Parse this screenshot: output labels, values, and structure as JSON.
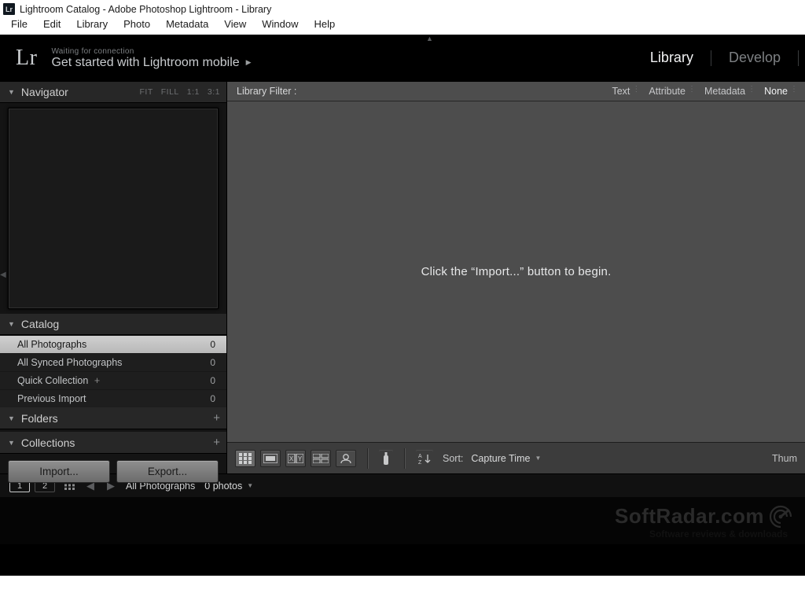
{
  "window": {
    "title": "Lightroom Catalog - Adobe Photoshop Lightroom - Library"
  },
  "menu": {
    "items": [
      "File",
      "Edit",
      "Library",
      "Photo",
      "Metadata",
      "View",
      "Window",
      "Help"
    ]
  },
  "identity": {
    "logo": "Lr",
    "status": "Waiting for connection",
    "cta": "Get started with Lightroom mobile"
  },
  "modules": {
    "items": [
      "Library",
      "Develop"
    ],
    "active": "Library"
  },
  "navigator": {
    "title": "Navigator",
    "zoom": [
      "FIT",
      "FILL",
      "1:1",
      "3:1"
    ]
  },
  "catalog": {
    "title": "Catalog",
    "items": [
      {
        "label": "All Photographs",
        "count": 0,
        "selected": true
      },
      {
        "label": "All Synced Photographs",
        "count": 0
      },
      {
        "label": "Quick Collection",
        "count": 0,
        "plus": true
      },
      {
        "label": "Previous Import",
        "count": 0
      }
    ]
  },
  "folders": {
    "title": "Folders"
  },
  "collections": {
    "title": "Collections"
  },
  "buttons": {
    "import": "Import...",
    "export": "Export..."
  },
  "filter": {
    "label": "Library Filter :",
    "options": [
      "Text",
      "Attribute",
      "Metadata",
      "None"
    ],
    "active": "None"
  },
  "grid": {
    "message": "Click the “Import...” button to begin."
  },
  "toolbar": {
    "sort_label": "Sort:",
    "sort_value": "Capture Time",
    "thumb_label": "Thum"
  },
  "status": {
    "screens": [
      "1",
      "2"
    ],
    "crumb": "All Photographs",
    "count": "0 photos"
  },
  "watermark": {
    "brand": "SoftRadar.com",
    "sub": "Software reviews & downloads"
  },
  "icons": {
    "grid": "grid-view-icon",
    "loupe": "loupe-view-icon",
    "compare": "compare-view-icon",
    "survey": "survey-view-icon",
    "people": "people-view-icon",
    "spray": "painter-icon",
    "az": "sort-direction-icon"
  }
}
